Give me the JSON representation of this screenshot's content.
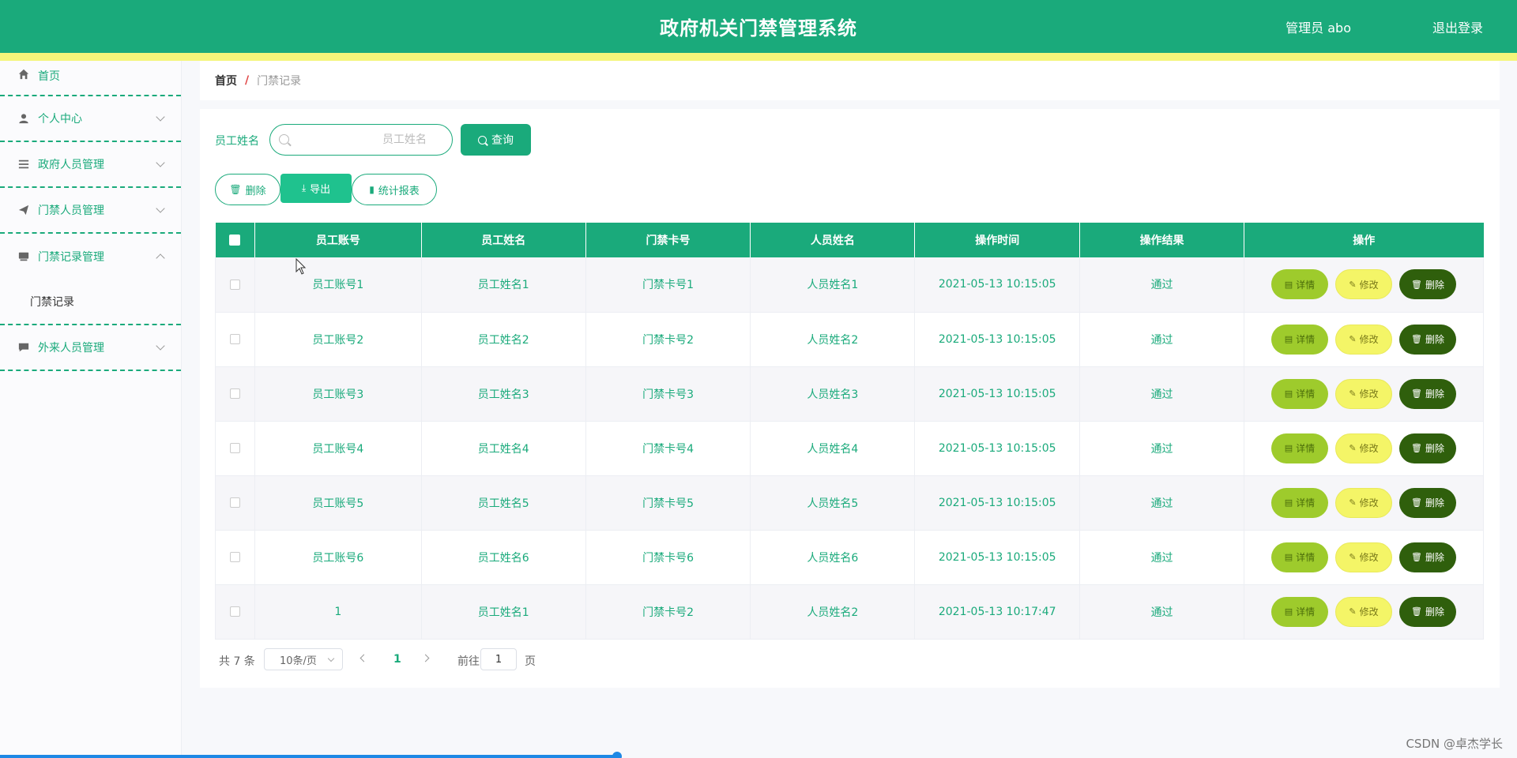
{
  "header": {
    "title": "政府机关门禁管理系统",
    "user": "管理员 abo",
    "logout": "退出登录"
  },
  "sidebar": {
    "items": [
      {
        "label": "首页",
        "icon": "home-icon"
      },
      {
        "label": "个人中心",
        "icon": "user-icon"
      },
      {
        "label": "政府人员管理",
        "icon": "list-icon"
      },
      {
        "label": "门禁人员管理",
        "icon": "send-icon"
      },
      {
        "label": "门禁记录管理",
        "icon": "box-icon"
      },
      {
        "label": "外来人员管理",
        "icon": "chat-icon"
      }
    ],
    "submenu": {
      "label": "门禁记录"
    }
  },
  "breadcrumb": {
    "home": "首页",
    "separator": "/",
    "current": "门禁记录"
  },
  "search": {
    "label": "员工姓名",
    "placeholder": "员工姓名",
    "button": "查询"
  },
  "actions": {
    "delete": "删除",
    "export": "导出",
    "report": "统计报表"
  },
  "table": {
    "headers": [
      "员工账号",
      "员工姓名",
      "门禁卡号",
      "人员姓名",
      "操作时间",
      "操作结果",
      "操作"
    ],
    "rows": [
      [
        "员工账号1",
        "员工姓名1",
        "门禁卡号1",
        "人员姓名1",
        "2021-05-13 10:15:05",
        "通过"
      ],
      [
        "员工账号2",
        "员工姓名2",
        "门禁卡号2",
        "人员姓名2",
        "2021-05-13 10:15:05",
        "通过"
      ],
      [
        "员工账号3",
        "员工姓名3",
        "门禁卡号3",
        "人员姓名3",
        "2021-05-13 10:15:05",
        "通过"
      ],
      [
        "员工账号4",
        "员工姓名4",
        "门禁卡号4",
        "人员姓名4",
        "2021-05-13 10:15:05",
        "通过"
      ],
      [
        "员工账号5",
        "员工姓名5",
        "门禁卡号5",
        "人员姓名5",
        "2021-05-13 10:15:05",
        "通过"
      ],
      [
        "员工账号6",
        "员工姓名6",
        "门禁卡号6",
        "人员姓名6",
        "2021-05-13 10:15:05",
        "通过"
      ],
      [
        "1",
        "员工姓名1",
        "门禁卡号2",
        "人员姓名2",
        "2021-05-13 10:17:47",
        "通过"
      ]
    ],
    "row_actions": {
      "detail": "详情",
      "edit": "修改",
      "delete": "删除"
    }
  },
  "pagination": {
    "total": "共 7 条",
    "page_size": "10条/页",
    "current_page": "1",
    "goto_label": "前往",
    "goto_value": "1",
    "page_suffix": "页"
  },
  "progress": {
    "fraction": 0.407
  },
  "watermark": "CSDN @卓杰学长",
  "colors": {
    "primary": "#1aaa7b",
    "stripe": "#f4f57a",
    "detail": "#9ecb2c",
    "edit": "#f4f567",
    "delete": "#2f5f0c"
  }
}
